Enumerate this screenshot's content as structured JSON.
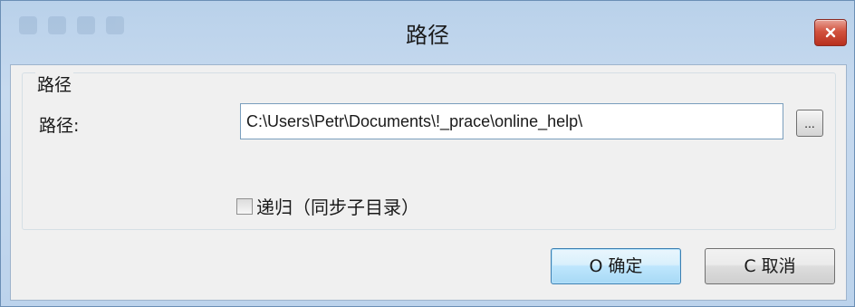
{
  "window": {
    "title": "路径",
    "close_icon": "close-icon"
  },
  "group": {
    "legend": "路径"
  },
  "path": {
    "label": "路径:",
    "value": "C:\\Users\\Petr\\Documents\\!_prace\\online_help\\",
    "browse_label": "..."
  },
  "recursive": {
    "label": "递归（同步子目录）",
    "checked": false
  },
  "buttons": {
    "ok_label": "O 确定",
    "cancel_label": "C 取消"
  },
  "colors": {
    "frame": "#b9d1ea",
    "close_button": "#c7402d",
    "client_background": "#f0f0f0"
  }
}
